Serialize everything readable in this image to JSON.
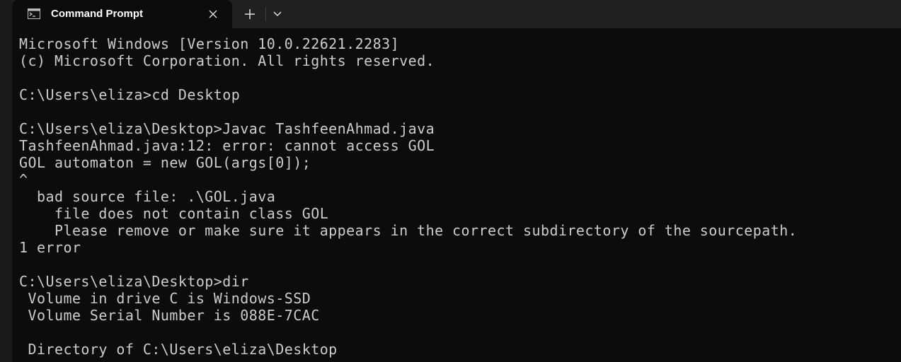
{
  "window": {
    "tab_title": "Command Prompt",
    "tab_icon": "command-prompt-icon",
    "close_icon": "close-icon",
    "new_tab_icon": "plus-icon",
    "dropdown_icon": "chevron-down-icon"
  },
  "colors": {
    "background": "#0c0c0c",
    "titlebar": "#202020",
    "text": "#cccccc"
  },
  "terminal": {
    "lines": [
      "Microsoft Windows [Version 10.0.22621.2283]",
      "(c) Microsoft Corporation. All rights reserved.",
      "",
      "C:\\Users\\eliza>cd Desktop",
      "",
      "C:\\Users\\eliza\\Desktop>Javac TashfeenAhmad.java",
      "TashfeenAhmad.java:12: error: cannot access GOL",
      "GOL automaton = new GOL(args[0]);",
      "^",
      "  bad source file: .\\GOL.java",
      "    file does not contain class GOL",
      "    Please remove or make sure it appears in the correct subdirectory of the sourcepath.",
      "1 error",
      "",
      "C:\\Users\\eliza\\Desktop>dir",
      " Volume in drive C is Windows-SSD",
      " Volume Serial Number is 088E-7CAC",
      "",
      " Directory of C:\\Users\\eliza\\Desktop"
    ]
  }
}
